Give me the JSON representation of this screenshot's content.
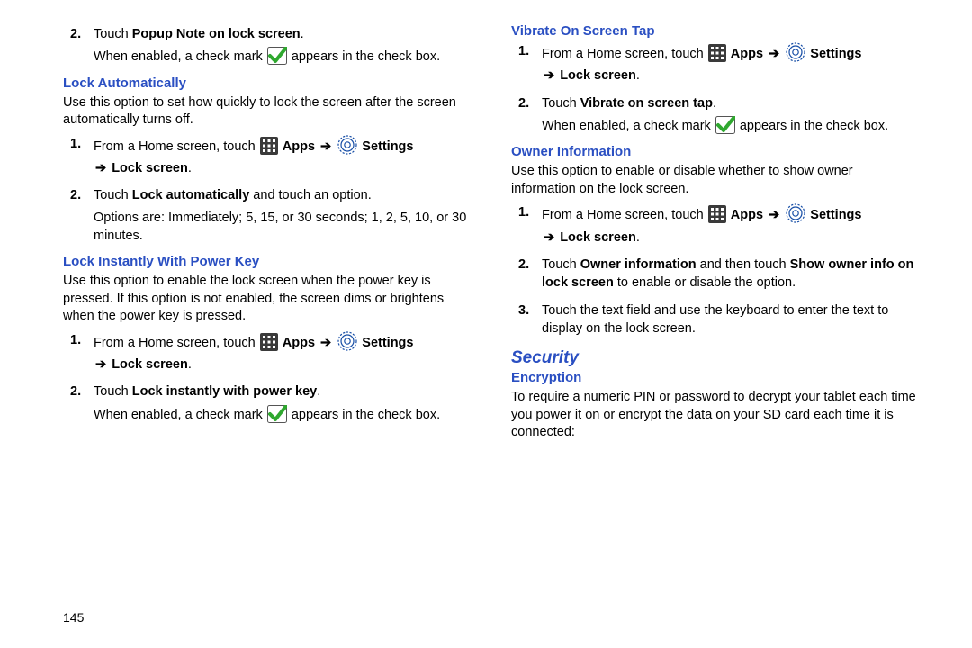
{
  "pagenum": "145",
  "labels": {
    "apps": "Apps",
    "settings": "Settings",
    "lockscreen_suffix": "Lock screen"
  },
  "left": {
    "intro_step2_a": "Touch ",
    "intro_step2_bold": "Popup Note on lock screen",
    "intro_step2_b": ".",
    "intro_enabled_a": "When enabled, a check mark ",
    "intro_enabled_b": " appears in the check box.",
    "h_lock_auto": "Lock Automatically",
    "lock_auto_desc": "Use this option to set how quickly to lock the screen after the screen automatically turns off.",
    "lock_auto_s1": "From a Home screen, touch ",
    "lock_auto_s2_a": "Touch ",
    "lock_auto_s2_bold": "Lock automatically",
    "lock_auto_s2_b": " and touch an option.",
    "lock_auto_s2_opts": "Options are: Immediately; 5, 15, or 30 seconds; 1, 2, 5, 10, or 30 minutes.",
    "h_lock_power": "Lock Instantly With Power Key",
    "lock_power_desc": "Use this option to enable the lock screen when the power key is pressed. If this option is not enabled, the screen dims or brightens when the power key is pressed.",
    "lock_power_s1": "From a Home screen, touch ",
    "lock_power_s2_a": "Touch ",
    "lock_power_s2_bold": "Lock instantly with power key",
    "lock_power_s2_b": ".",
    "lock_power_enabled_a": "When enabled, a check mark ",
    "lock_power_enabled_b": " appears in the check box."
  },
  "right": {
    "h_vibrate": "Vibrate On Screen Tap",
    "vibrate_s1": "From a Home screen, touch ",
    "vibrate_s2_a": "Touch ",
    "vibrate_s2_bold": "Vibrate on screen tap",
    "vibrate_s2_b": ".",
    "vibrate_enabled_a": "When enabled, a check mark ",
    "vibrate_enabled_b": " appears in the check box.",
    "h_owner": "Owner Information",
    "owner_desc": "Use this option to enable or disable whether to show owner information on the lock screen.",
    "owner_s1": "From a Home screen, touch ",
    "owner_s2_a": "Touch ",
    "owner_s2_bold1": "Owner information",
    "owner_s2_mid": " and then touch ",
    "owner_s2_bold2": "Show owner info on lock screen",
    "owner_s2_b": " to enable or disable the option.",
    "owner_s3": "Touch the text field and use the keyboard to enter the text to display on the lock screen.",
    "h_security": "Security",
    "h_encryption": "Encryption",
    "encryption_desc": "To require a numeric PIN or password to decrypt your tablet each time you power it on or encrypt the data on your SD card each time it is connected:"
  }
}
